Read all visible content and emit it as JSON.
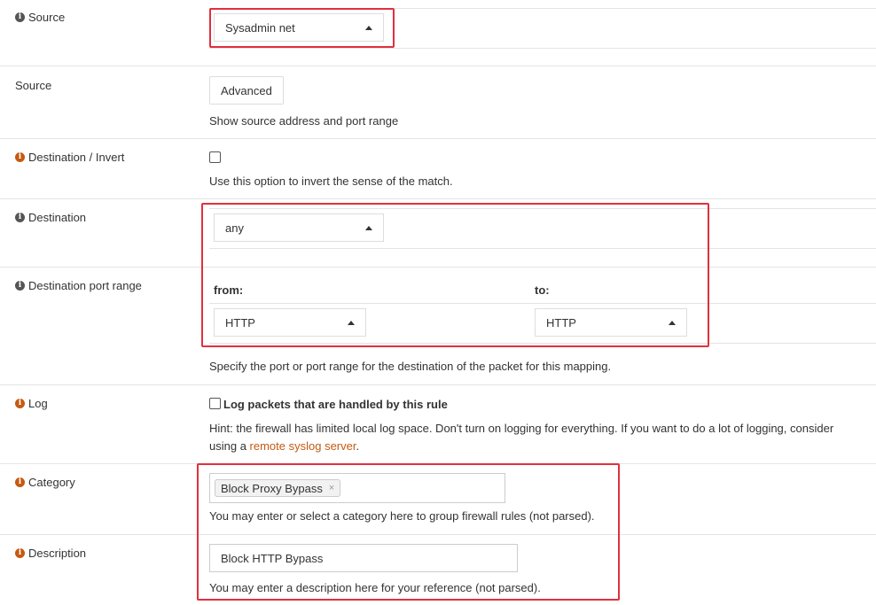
{
  "source": {
    "label": "Source",
    "selected": "Sysadmin net"
  },
  "source_advanced": {
    "label": "Source",
    "button_label": "Advanced",
    "help": "Show source address and port range"
  },
  "destination_invert": {
    "label": "Destination / Invert",
    "help": "Use this option to invert the sense of the match."
  },
  "destination": {
    "label": "Destination",
    "selected": "any"
  },
  "destination_port_range": {
    "label": "Destination port range",
    "from_label": "from:",
    "to_label": "to:",
    "from_selected": "HTTP",
    "to_selected": "HTTP",
    "help": "Specify the port or port range for the destination of the packet for this mapping."
  },
  "log": {
    "label": "Log",
    "checkbox_label": "Log packets that are handled by this rule",
    "hint_line1": "Hint: the firewall has limited local log space. Don't turn on logging for everything. If you want to do a lot of logging, consider",
    "hint_prefix": "using a ",
    "hint_link": "remote syslog server",
    "hint_suffix": "."
  },
  "category": {
    "label": "Category",
    "tag": "Block Proxy Bypass",
    "tag_remove": "×",
    "help": "You may enter or select a category here to group firewall rules (not parsed)."
  },
  "description": {
    "label": "Description",
    "value": "Block HTTP Bypass",
    "help": "You may enter a description here for your reference (not parsed)."
  },
  "colors": {
    "highlight": "#e0303e",
    "link": "#c55a11",
    "info_icon_dark": "#555555",
    "info_icon_orange": "#c55a11"
  }
}
